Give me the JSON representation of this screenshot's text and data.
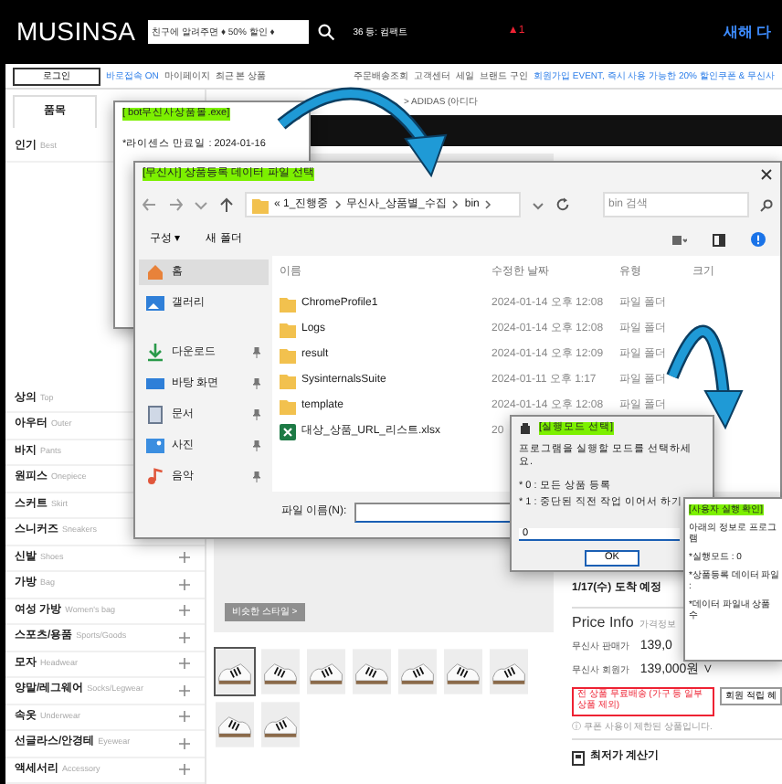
{
  "header": {
    "logo": "MUSINSA",
    "search_placeholder": "친구에 알려주면 ♦ 50% 할인 ♦",
    "ranking": "36 등: 컴팩트",
    "alert": "▲1",
    "promo": "새해 다"
  },
  "nav": {
    "login": "로그인",
    "links": [
      {
        "label": "바로접속 ON",
        "highlighted": true
      },
      {
        "label": "마이페이지",
        "highlighted": false
      },
      {
        "label": "최근 본 상품",
        "highlighted": false
      },
      {
        "label": "주문배송조회",
        "highlighted": false
      },
      {
        "label": "고객센터",
        "highlighted": false
      },
      {
        "label": "세일",
        "highlighted": false
      },
      {
        "label": "브랜드 구인",
        "highlighted": false
      },
      {
        "label": "회원가입 EVENT, 즉시 사용 가능한 20% 할인쿠폰 & 무신사",
        "highlighted": true
      }
    ]
  },
  "sidebar": {
    "tabs": [
      {
        "label": "품목",
        "selected": true
      }
    ],
    "best": {
      "label": "인기",
      "en": "Best"
    },
    "categories": [
      {
        "label": "상의",
        "en": "Top"
      },
      {
        "label": "아우터",
        "en": "Outer"
      },
      {
        "label": "바지",
        "en": "Pants"
      },
      {
        "label": "원피스",
        "en": "Onepiece"
      },
      {
        "label": "스커트",
        "en": "Skirt"
      },
      {
        "label": "스니커즈",
        "en": "Sneakers"
      },
      {
        "label": "신발",
        "en": "Shoes",
        "expandable": true
      },
      {
        "label": "가방",
        "en": "Bag",
        "expandable": true
      },
      {
        "label": "여성 가방",
        "en": "Women's bag",
        "expandable": true
      },
      {
        "label": "스포츠/용품",
        "en": "Sports/Goods",
        "expandable": true
      },
      {
        "label": "모자",
        "en": "Headwear",
        "expandable": true
      },
      {
        "label": "양말/레그웨어",
        "en": "Socks/Legwear",
        "expandable": true
      },
      {
        "label": "속옷",
        "en": "Underwear",
        "expandable": true
      },
      {
        "label": "선글라스/안경테",
        "en": "Eyewear",
        "expandable": true
      },
      {
        "label": "액세서리",
        "en": "Accessory",
        "expandable": true
      }
    ]
  },
  "product": {
    "breadcrumb": "> ADIDAS (아디다",
    "style_button": "비슷한 스타일 >",
    "thumbnails": [
      {
        "kind": "picture",
        "selected": true
      },
      {
        "kind": "picture",
        "selected": false
      },
      {
        "kind": "picture",
        "selected": false
      },
      {
        "kind": "picture",
        "selected": false
      },
      {
        "kind": "picture",
        "selected": false
      },
      {
        "kind": "picture",
        "selected": false
      },
      {
        "kind": "picture",
        "selected": false
      },
      {
        "kind": "picture",
        "selected": false
      },
      {
        "kind": "picture",
        "selected": false
      }
    ],
    "delivery": "1/17(수) 도착 예정",
    "price_title": "Price Info",
    "price_sub": "가격정보",
    "prices": [
      {
        "label": "무신사 판매가",
        "value": "139,0"
      },
      {
        "label": "무신사 회원가",
        "value": "139,000원 ∨"
      }
    ],
    "buttons": [
      {
        "label": "전 상품 무료배송 (가구 등 일부 상품 제외)",
        "kind": "red"
      },
      {
        "label": "회원 적립 혜",
        "kind": "plain"
      }
    ],
    "notice": "ⓘ 쿠폰 사용이 제한된 상품입니다.",
    "calculator": "최저가 계산기"
  },
  "license_dialog": {
    "title": "[ bot무신사상품몰.exe]",
    "highlighted": true,
    "text": "*라이센스 만료일 : 2024-01-16"
  },
  "file_dialog": {
    "title": "[무신사] 상품등록 데이터 파일 선택",
    "highlighted": true,
    "path": [
      "« 1_진행중",
      "무신사_상품별_수집",
      "bin"
    ],
    "search_placeholder": "bin 검색",
    "toolbar": [
      "구성 ▾",
      "새 폴더"
    ],
    "places": [
      {
        "label": "홈",
        "kind": "home",
        "selected": true,
        "pinned": false
      },
      {
        "label": "갤러리",
        "kind": "gallery",
        "selected": false,
        "pinned": false
      },
      {
        "label": "다운로드",
        "kind": "download",
        "selected": false,
        "pinned": true
      },
      {
        "label": "바탕 화면",
        "kind": "desktop",
        "selected": false,
        "pinned": true
      },
      {
        "label": "문서",
        "kind": "document",
        "selected": false,
        "pinned": true
      },
      {
        "label": "사진",
        "kind": "pictures",
        "selected": false,
        "pinned": true
      },
      {
        "label": "음악",
        "kind": "music",
        "selected": false,
        "pinned": true
      }
    ],
    "columns": [
      "이름",
      "수정한 날짜",
      "유형",
      "크기"
    ],
    "files": [
      {
        "name": "ChromeProfile1",
        "kind": "folder",
        "date": "2024-01-14 오후 12:08",
        "type": "파일 폴더"
      },
      {
        "name": "Logs",
        "kind": "folder",
        "date": "2024-01-14 오후 12:08",
        "type": "파일 폴더"
      },
      {
        "name": "result",
        "kind": "folder",
        "date": "2024-01-14 오후 12:09",
        "type": "파일 폴더"
      },
      {
        "name": "SysinternalsSuite",
        "kind": "folder",
        "date": "2024-01-11 오후 1:17",
        "type": "파일 폴더"
      },
      {
        "name": "template",
        "kind": "folder",
        "date": "2024-01-14 오후 12:08",
        "type": "파일 폴더"
      },
      {
        "name": "대상_상품_URL_리스트.xlsx",
        "kind": "excel",
        "date": "20"
      }
    ],
    "filename_label": "파일 이름(N):"
  },
  "mode_dialog": {
    "title": "[실행모드 선택]",
    "highlighted": true,
    "prompt": "프로그램을 실행할 모드를 선택하세요.",
    "options": [
      "* 0 : 모든 상품 등록",
      "* 1 : 중단된 직전 작업 이어서 하기"
    ],
    "value": "0",
    "ok": "OK"
  },
  "confirm_dialog": {
    "title": "[사용자 실행 확인]",
    "highlighted": true,
    "lines": [
      "아래의 정보로 프로그램",
      "*실행모드 : 0",
      "*상품등록 데이터 파일 :",
      "*데이터 파일내 상품 수"
    ]
  }
}
